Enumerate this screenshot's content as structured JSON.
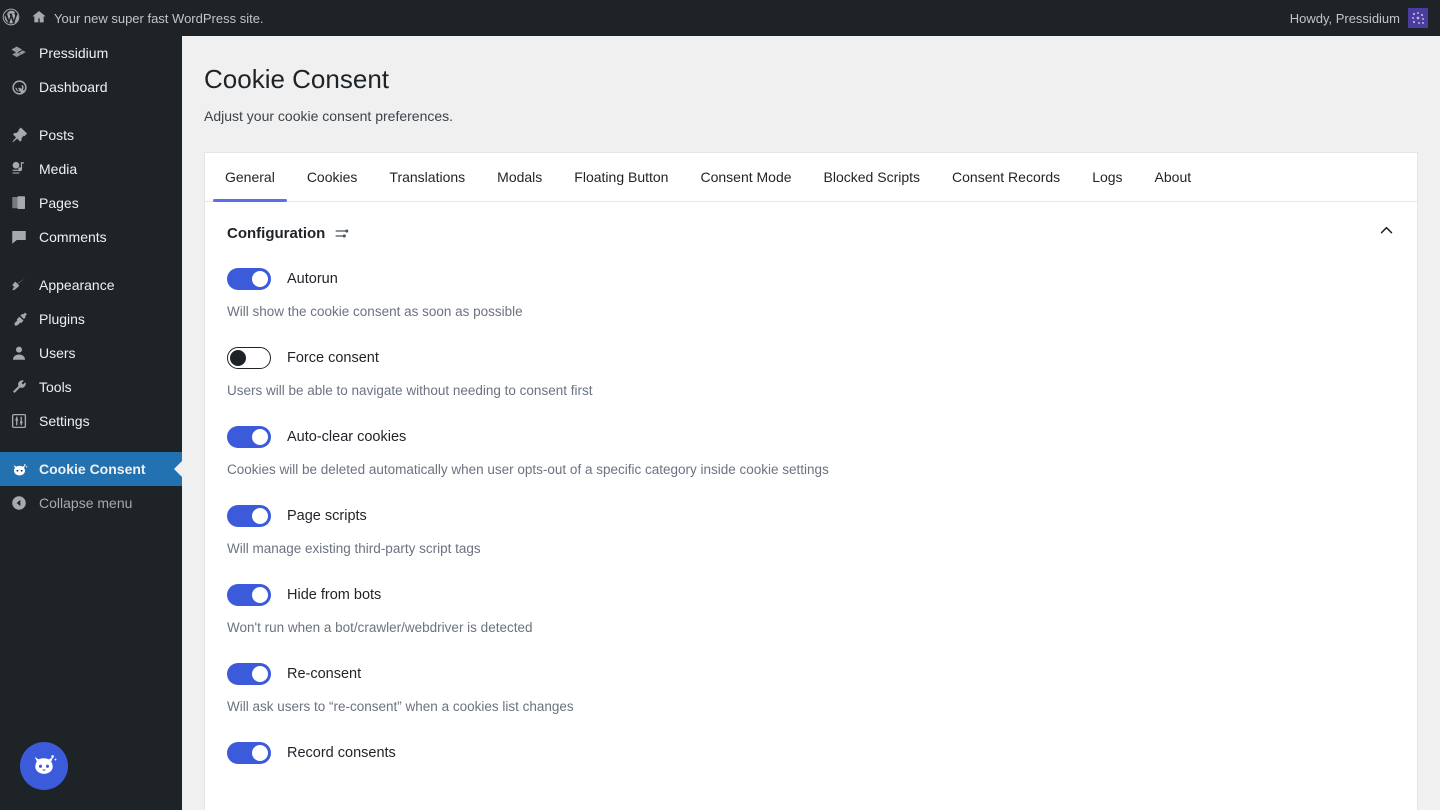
{
  "adminbar": {
    "wp_logo_icon": "wordpress-logo-icon",
    "home_icon": "home-icon",
    "site_title": "Your new super fast WordPress site.",
    "howdy": "Howdy, Pressidium",
    "avatar_icon": "avatar"
  },
  "sidebar": {
    "groups": [
      {
        "items": [
          {
            "label": "Pressidium",
            "icon": "pressidium-icon",
            "current": false
          },
          {
            "label": "Dashboard",
            "icon": "dashboard-gauge-icon",
            "current": false
          }
        ]
      },
      {
        "items": [
          {
            "label": "Posts",
            "icon": "pin-icon",
            "current": false
          },
          {
            "label": "Media",
            "icon": "media-icon",
            "current": false
          },
          {
            "label": "Pages",
            "icon": "pages-icon",
            "current": false
          },
          {
            "label": "Comments",
            "icon": "comment-bubble-icon",
            "current": false
          }
        ]
      },
      {
        "items": [
          {
            "label": "Appearance",
            "icon": "paintbrush-icon",
            "current": false
          },
          {
            "label": "Plugins",
            "icon": "plug-icon",
            "current": false
          },
          {
            "label": "Users",
            "icon": "user-icon",
            "current": false
          },
          {
            "label": "Tools",
            "icon": "wrench-icon",
            "current": false
          },
          {
            "label": "Settings",
            "icon": "sliders-icon",
            "current": false
          }
        ]
      },
      {
        "items": [
          {
            "label": "Cookie Consent",
            "icon": "cookie-consent-cat-icon",
            "current": true
          }
        ]
      }
    ],
    "collapse": {
      "label": "Collapse menu",
      "icon": "collapse-arrow-icon"
    },
    "current_color": "#2271b1"
  },
  "floating_button": {
    "icon": "cookie-consent-cat-icon",
    "color": "#3b5bdb"
  },
  "page": {
    "title": "Cookie Consent",
    "subtitle": "Adjust your cookie consent preferences."
  },
  "tabs": {
    "active_underline_color": "#5b6ee8",
    "items": [
      {
        "label": "General",
        "active": true
      },
      {
        "label": "Cookies",
        "active": false
      },
      {
        "label": "Translations",
        "active": false
      },
      {
        "label": "Modals",
        "active": false
      },
      {
        "label": "Floating Button",
        "active": false
      },
      {
        "label": "Consent Mode",
        "active": false
      },
      {
        "label": "Blocked Scripts",
        "active": false
      },
      {
        "label": "Consent Records",
        "active": false
      },
      {
        "label": "Logs",
        "active": false
      },
      {
        "label": "About",
        "active": false
      }
    ]
  },
  "section": {
    "title": "Configuration",
    "icon": "tune-sliders-icon",
    "collapse_icon": "chevron-up-icon"
  },
  "settings": {
    "toggle_on_color": "#3b5bdb",
    "rows": [
      {
        "label": "Autorun",
        "state": "on",
        "description": "Will show the cookie consent as soon as possible"
      },
      {
        "label": "Force consent",
        "state": "off",
        "description": "Users will be able to navigate without needing to consent first"
      },
      {
        "label": "Auto-clear cookies",
        "state": "on",
        "description": "Cookies will be deleted automatically when user opts-out of a specific category inside cookie settings"
      },
      {
        "label": "Page scripts",
        "state": "on",
        "description": "Will manage existing third-party script tags"
      },
      {
        "label": "Hide from bots",
        "state": "on",
        "description": "Won't run when a bot/crawler/webdriver is detected"
      },
      {
        "label": "Re-consent",
        "state": "on",
        "description": "Will ask users to “re-consent” when a cookies list changes"
      },
      {
        "label": "Record consents",
        "state": "on",
        "description": ""
      }
    ]
  }
}
